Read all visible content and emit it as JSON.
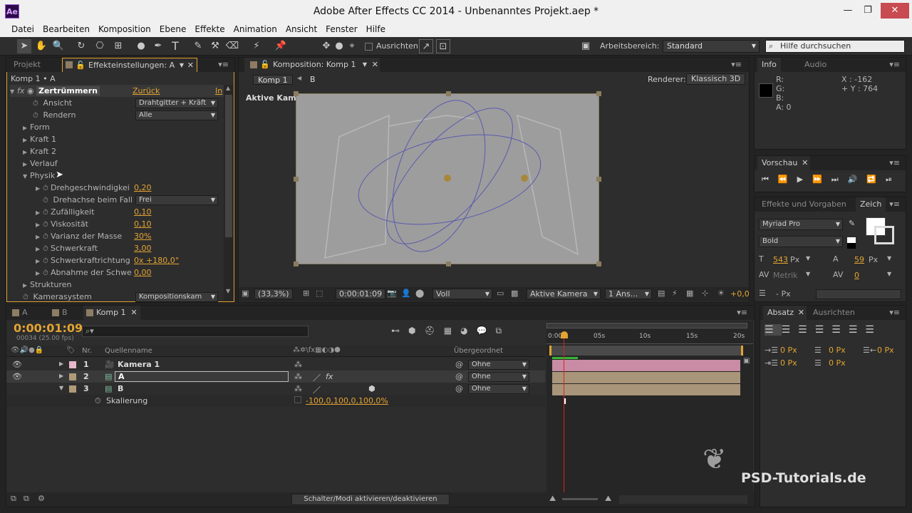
{
  "window": {
    "title": "Adobe After Effects CC 2014 - Unbenanntes Projekt.aep *",
    "app_icon": "Ae",
    "minimize": "—",
    "restore": "❐",
    "close": "✕"
  },
  "menu": [
    "Datei",
    "Bearbeiten",
    "Komposition",
    "Ebene",
    "Effekte",
    "Animation",
    "Ansicht",
    "Fenster",
    "Hilfe"
  ],
  "toolbar": {
    "snap_label": "Ausrichten",
    "workspace_label": "Arbeitsbereich:",
    "workspace_value": "Standard",
    "search_placeholder": "Hilfe durchsuchen"
  },
  "effects_panel": {
    "tabs": [
      "Projekt",
      "Effekteinstellungen: A"
    ],
    "breadcrumb": "Komp 1 • A",
    "effect_name": "Zertrümmern",
    "reset": "Zurück",
    "info": "In",
    "rows": [
      {
        "label": "Ansicht",
        "value": "Drahtgitter + Kräft"
      },
      {
        "label": "Rendern",
        "value": "Alle"
      },
      {
        "label": "Form"
      },
      {
        "label": "Kraft 1"
      },
      {
        "label": "Kraft 2"
      },
      {
        "label": "Verlauf"
      },
      {
        "label": "Physik"
      },
      {
        "label": "Drehgeschwindigkei",
        "value": "0,20"
      },
      {
        "label": "Drehachse beim Fall",
        "value": "Frei"
      },
      {
        "label": "Zufälligkeit",
        "value": "0,10"
      },
      {
        "label": "Viskosität",
        "value": "0,10"
      },
      {
        "label": "Varianz der Masse",
        "value": "30%"
      },
      {
        "label": "Schwerkraft",
        "value": "3,00"
      },
      {
        "label": "Schwerkraftrichtung",
        "value": "0x +180,0°"
      },
      {
        "label": "Abnahme der Schwe",
        "value": "0,00"
      },
      {
        "label": "Strukturen"
      },
      {
        "label": "Kamerasystem",
        "value": "Kompositionskam"
      }
    ]
  },
  "comp_panel": {
    "tab": "Komposition: Komp 1",
    "crumb1": "Komp 1",
    "crumb2": "B",
    "renderer_label": "Renderer:",
    "renderer_value": "Klassisch 3D",
    "camera_label": "Aktive Kamera",
    "footer": {
      "zoom": "(33,3%)",
      "time": "0:00:01:09",
      "resolution": "Voll",
      "view": "Aktive Kamera",
      "views": "1 Ans...",
      "offset": "+0,0"
    }
  },
  "info_panel": {
    "tabs": [
      "Info",
      "Audio"
    ],
    "r": "R:",
    "g": "G:",
    "b": "B:",
    "a": "A:",
    "a_val": "0",
    "x": "X : -162",
    "y": "+ Y : 764"
  },
  "preview_panel": {
    "tab": "Vorschau"
  },
  "char_panel": {
    "tabs": [
      "Effekte und Vorgaben",
      "Zeich"
    ],
    "font": "Myriad Pro",
    "style": "Bold",
    "size": "543",
    "size_unit": "Px",
    "leading": "59",
    "leading_unit": "Px",
    "kerning": "Metrik",
    "tracking": "0",
    "stroke": "- Px"
  },
  "para_panel": {
    "tabs": [
      "Absatz",
      "Ausrichten"
    ],
    "indent1": "0 Px",
    "indent2": "0 Px",
    "indent3": "0 Px",
    "space1": "0 Px",
    "space2": "0 Px"
  },
  "timeline": {
    "tabs": [
      "A",
      "B",
      "Komp 1"
    ],
    "timecode": "0:00:01:09",
    "frames": "00034 (25.00 fps)",
    "col_nr": "Nr.",
    "col_source": "Quellenname",
    "col_parent": "Übergeordnet",
    "ruler": [
      "0:00s",
      "05s",
      "10s",
      "15s",
      "20s"
    ],
    "layers": [
      {
        "nr": "1",
        "name": "Kamera 1",
        "parent": "Ohne"
      },
      {
        "nr": "2",
        "name": "A",
        "parent": "Ohne"
      },
      {
        "nr": "3",
        "name": "B",
        "parent": "Ohne"
      }
    ],
    "prop_label": "Skalierung",
    "prop_value": "-100,0,100,0,100,0%",
    "toggle_btn": "Schalter/Modi aktivieren/deaktivieren"
  },
  "watermark": "PSD-Tutorials.de"
}
